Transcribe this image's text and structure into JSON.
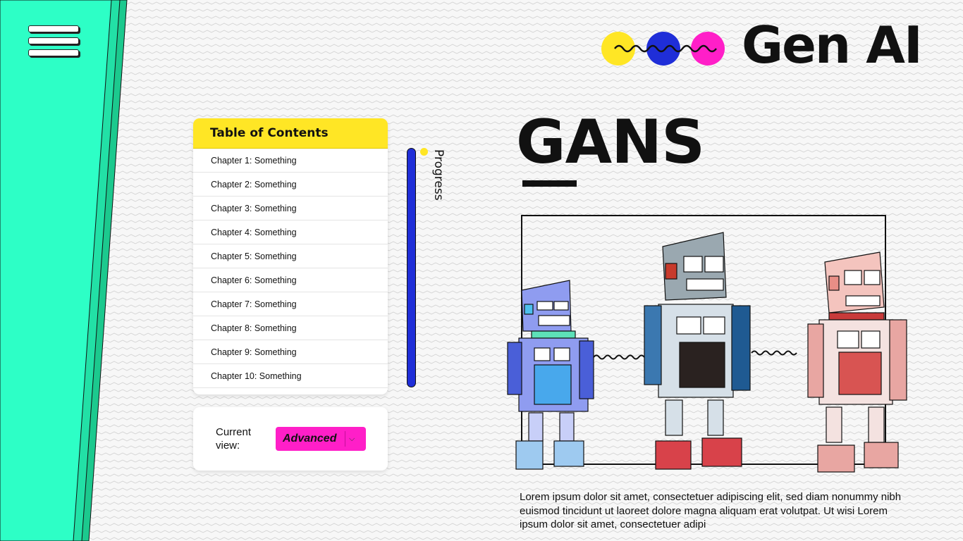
{
  "menu": {
    "icon": "hamburger-menu-icon"
  },
  "brand": {
    "text": "Gen AI",
    "dot_colors": [
      "#ffe625",
      "#1f2ed8",
      "#ff1fc8"
    ]
  },
  "toc": {
    "title": "Table of Contents",
    "items": [
      "Chapter 1: Something",
      "Chapter 2: Something",
      "Chapter 3: Something",
      "Chapter 4: Something",
      "Chapter 5: Something",
      "Chapter 6: Something",
      "Chapter 7: Something",
      "Chapter 8: Something",
      "Chapter 9: Something",
      "Chapter 10: Something"
    ]
  },
  "progress": {
    "label": "Progress"
  },
  "view": {
    "label": "Current view:",
    "value": "Advanced"
  },
  "article": {
    "title": "GANS",
    "body": "Lorem ipsum dolor sit amet, consectetuer adipiscing elit, sed diam nonummy nibh euismod tincidunt ut laoreet dolore magna aliquam erat volutpat. Ut wisi Lorem ipsum dolor sit amet, consectetuer adipi",
    "image_alt": "three-robots-illustration"
  },
  "colors": {
    "accent_teal": "#2dffc6",
    "yellow": "#ffe625",
    "blue": "#1f2ed8",
    "magenta": "#ff1fc8"
  }
}
